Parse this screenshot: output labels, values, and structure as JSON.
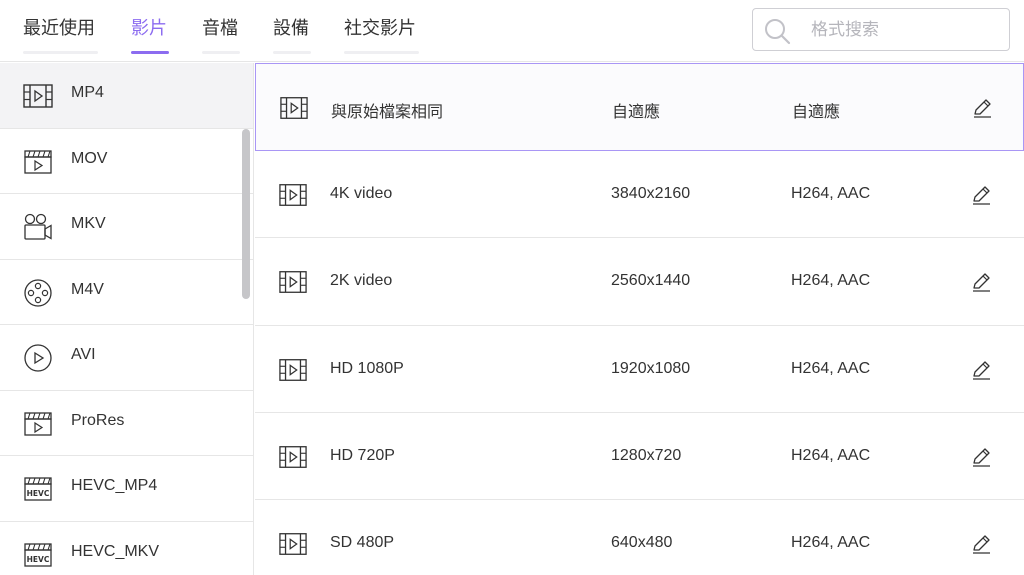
{
  "tabs": [
    {
      "label": "最近使用",
      "active": false
    },
    {
      "label": "影片",
      "active": true
    },
    {
      "label": "音檔",
      "active": false
    },
    {
      "label": "設備",
      "active": false
    },
    {
      "label": "社交影片",
      "active": false
    }
  ],
  "search": {
    "placeholder": "格式搜索",
    "value": "",
    "icon": "search-icon"
  },
  "sidebar": {
    "items": [
      {
        "label": "MP4",
        "icon": "film-icon",
        "selected": true
      },
      {
        "label": "MOV",
        "icon": "clapperboard-icon",
        "selected": false
      },
      {
        "label": "MKV",
        "icon": "video-camera-icon",
        "selected": false
      },
      {
        "label": "M4V",
        "icon": "film-reel-icon",
        "selected": false
      },
      {
        "label": "AVI",
        "icon": "play-circle-icon",
        "selected": false
      },
      {
        "label": "ProRes",
        "icon": "clapperboard-icon",
        "selected": false
      },
      {
        "label": "HEVC_MP4",
        "icon": "hevc-clapperboard-icon",
        "selected": false
      },
      {
        "label": "HEVC_MKV",
        "icon": "hevc-clapperboard-icon",
        "selected": false
      }
    ]
  },
  "presets": [
    {
      "name": "與原始檔案相同",
      "resolution": "自適應",
      "codec": "自適應",
      "selected": true
    },
    {
      "name": "4K video",
      "resolution": "3840x2160",
      "codec": "H264, AAC",
      "selected": false
    },
    {
      "name": "2K video",
      "resolution": "2560x1440",
      "codec": "H264, AAC",
      "selected": false
    },
    {
      "name": "HD 1080P",
      "resolution": "1920x1080",
      "codec": "H264, AAC",
      "selected": false
    },
    {
      "name": "HD 720P",
      "resolution": "1280x720",
      "codec": "H264, AAC",
      "selected": false
    },
    {
      "name": "SD 480P",
      "resolution": "640x480",
      "codec": "H264, AAC",
      "selected": false
    }
  ],
  "hevc_badge_text": "HEVC",
  "colors": {
    "accent": "#8c6cf0",
    "selected_border": "#a996f5",
    "icon": "#333333",
    "divider": "#e6e6e6"
  }
}
